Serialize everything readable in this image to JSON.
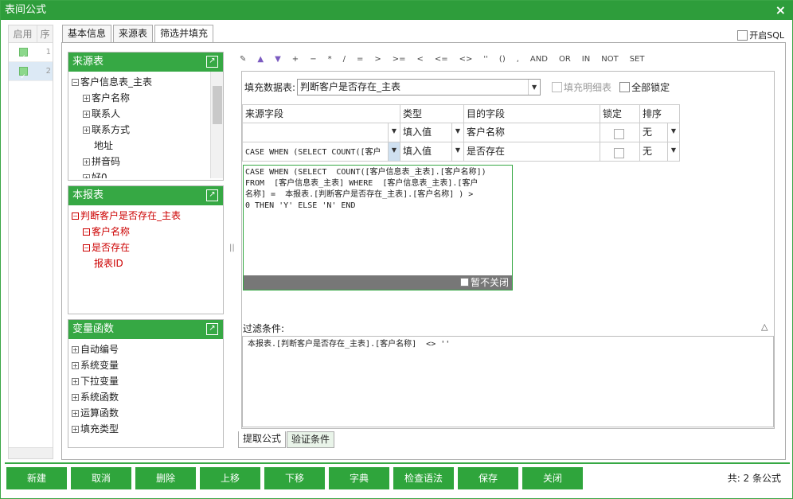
{
  "window": {
    "title": "表间公式",
    "close": "×"
  },
  "leftlist": {
    "headers": [
      "启用",
      "序"
    ],
    "rows": [
      {
        "num": "1"
      },
      {
        "num": "2"
      }
    ]
  },
  "tabs": [
    "基本信息",
    "来源表",
    "筛选并填充"
  ],
  "open_sql": "开启SQL",
  "source_panel": {
    "title": "来源表",
    "root": "客户信息表_主表",
    "items": [
      "客户名称",
      "联系人",
      "联系方式",
      "地址",
      "拼音码",
      "好0"
    ]
  },
  "this_panel": {
    "title": "本报表",
    "root": "判断客户是否存在_主表",
    "items": [
      "客户名称",
      "是否存在",
      "报表ID"
    ]
  },
  "func_panel": {
    "title": "变量函数",
    "items": [
      "自动编号",
      "系统变量",
      "下拉变量",
      "系统函数",
      "运算函数",
      "填充类型"
    ]
  },
  "toolbar": [
    "+",
    "−",
    "*",
    "/",
    "=",
    ">",
    ">=",
    "<",
    "<=",
    "<>",
    "''",
    "()",
    ",",
    "AND",
    "OR",
    "IN",
    "NOT",
    "SET"
  ],
  "fill": {
    "label": "填充数据表:",
    "value": "判断客户是否存在_主表",
    "detail": "填充明细表",
    "lockall": "全部锁定"
  },
  "grid": {
    "headers": [
      "来源字段",
      "类型",
      "目的字段",
      "锁定",
      "排序"
    ],
    "rows": [
      {
        "src": "",
        "type": "填入值",
        "dest": "客户名称",
        "sort": "无"
      },
      {
        "src": "CASE WHEN (SELECT  COUNT([客户",
        "type": "填入值",
        "dest": "是否存在",
        "sort": "无"
      }
    ]
  },
  "editor": {
    "text": "CASE WHEN (SELECT  COUNT([客户信息表_主表].[客户名称])\nFROM  [客户信息表_主表] WHERE  [客户信息表_主表].[客户\n名称] =  本报表.[判断客户是否存在_主表].[客户名称] ) >\n0 THEN 'Y' ELSE 'N' END",
    "keepopen": "暂不关闭"
  },
  "filter": {
    "label": "过滤条件:",
    "text": "本报表.[判断客户是否存在_主表].[客户名称]  <> ''"
  },
  "bottom_tabs": [
    "提取公式",
    "验证条件"
  ],
  "buttons": [
    "新建",
    "取消",
    "删除",
    "上移",
    "下移",
    "字典",
    "检查语法",
    "保存",
    "关闭"
  ],
  "total": "共: 2 条公式"
}
